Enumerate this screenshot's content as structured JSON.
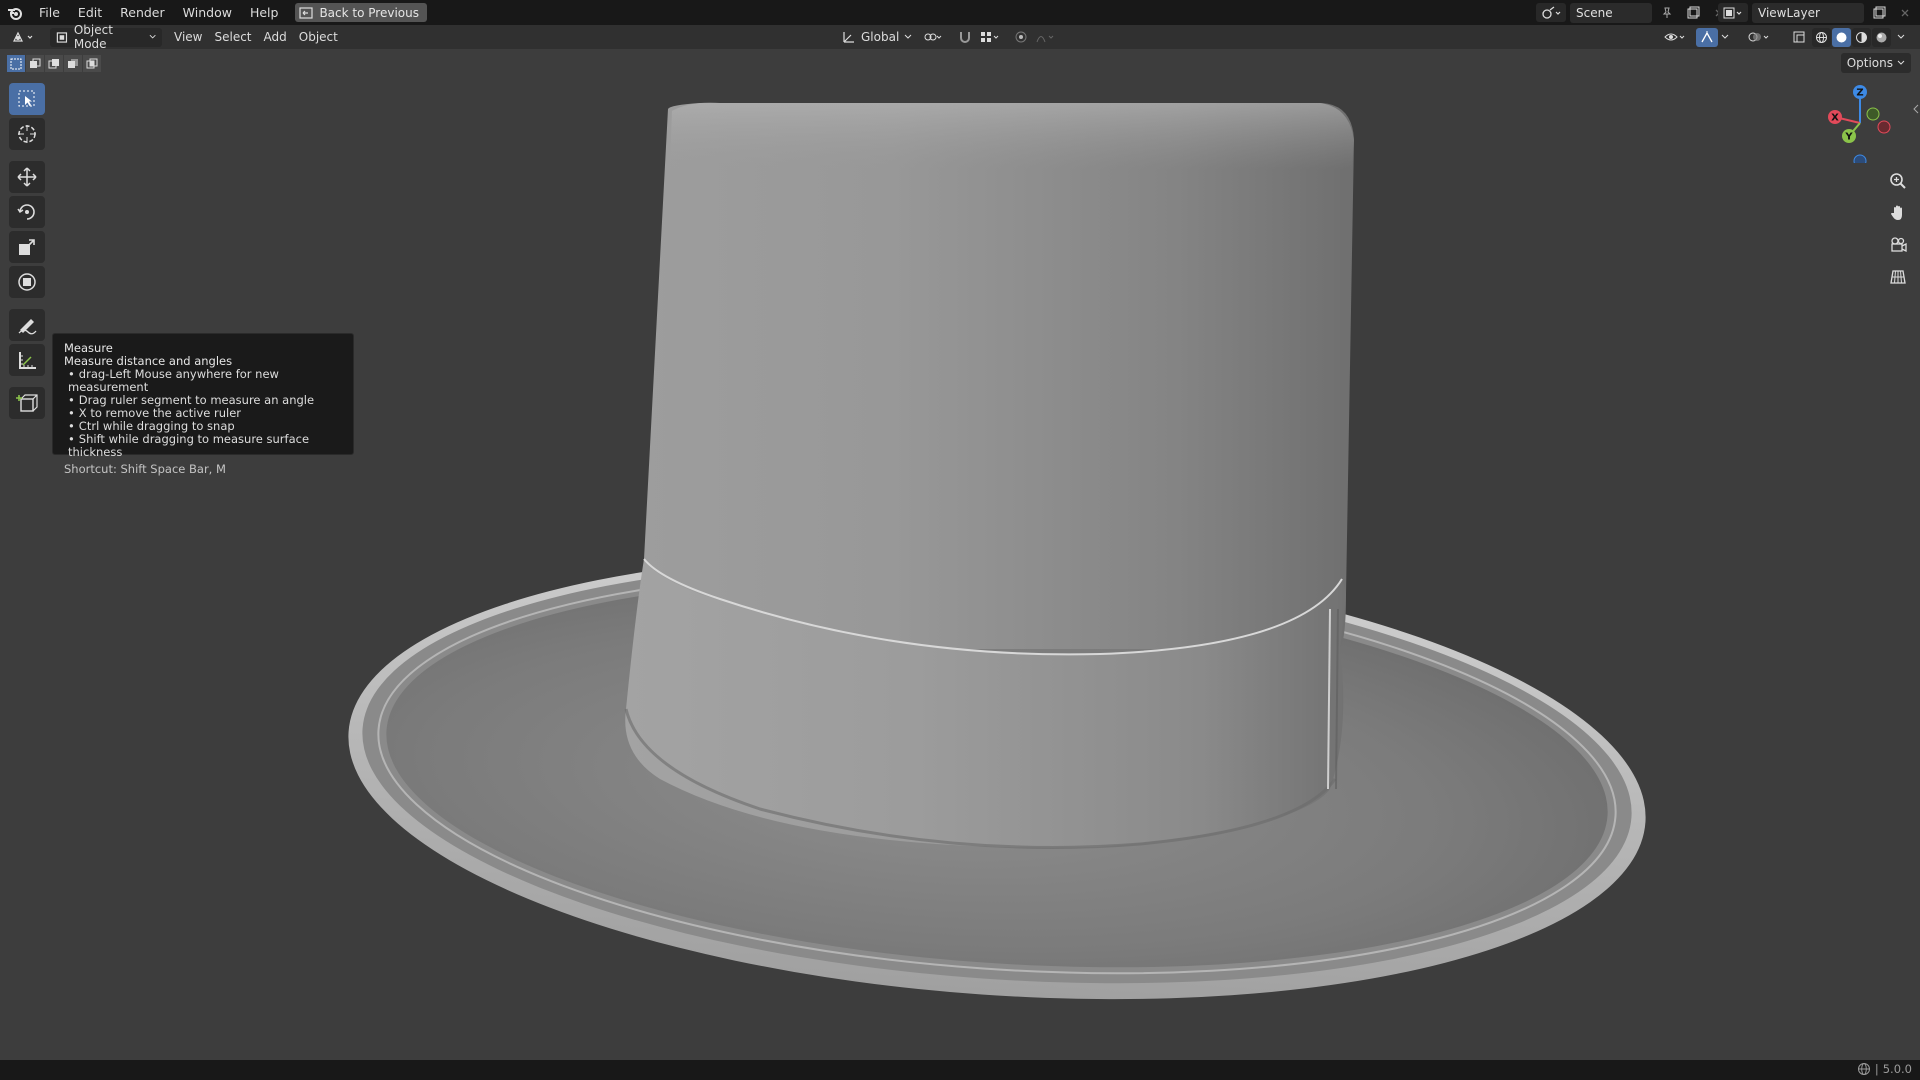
{
  "menu": {
    "items": [
      "File",
      "Edit",
      "Render",
      "Window",
      "Help"
    ],
    "back_button": "Back to Previous"
  },
  "scene": {
    "name": "Scene"
  },
  "view_layer": {
    "name": "ViewLayer"
  },
  "header": {
    "mode": "Object Mode",
    "menus": [
      "View",
      "Select",
      "Add",
      "Object"
    ],
    "orientation": "Global",
    "options_label": "Options"
  },
  "tooltip": {
    "title": "Measure",
    "description": "Measure distance and angles",
    "bullets": [
      "drag-Left Mouse anywhere for new measurement",
      "Drag ruler segment to measure an angle",
      "X to remove the active ruler",
      "Ctrl while dragging to snap",
      "Shift while dragging to measure surface thickness"
    ],
    "shortcut": "Shortcut: Shift Space Bar, M"
  },
  "gizmo": {
    "x_label": "X",
    "y_label": "Y",
    "z_label": "Z",
    "colors": {
      "x": "#e34a5a",
      "y": "#8bc34a",
      "z": "#3d8ae6"
    }
  },
  "status": {
    "version": "5.0.0"
  },
  "colors": {
    "accent": "#4a6fa5",
    "background": "#3d3d3d",
    "topbar": "#181818"
  }
}
